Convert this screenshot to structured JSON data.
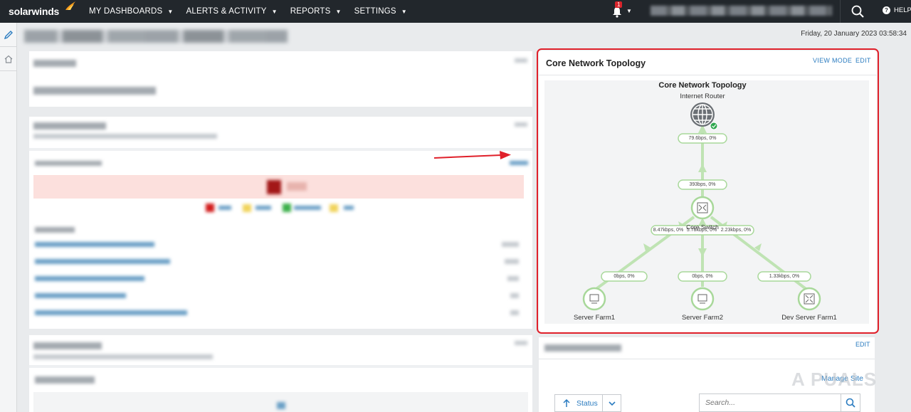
{
  "app": {
    "logo_text": "solarwinds"
  },
  "nav": {
    "items": [
      {
        "label": "MY DASHBOARDS"
      },
      {
        "label": "ALERTS & ACTIVITY"
      },
      {
        "label": "REPORTS"
      },
      {
        "label": "SETTINGS"
      }
    ],
    "notification_count": "1",
    "help_label": "HELP"
  },
  "header": {
    "datetime": "Friday, 20 January 2023 03:58:34"
  },
  "topology": {
    "title": "Core Network Topology",
    "view_mode_label": "VIEW MODE",
    "edit_label": "EDIT",
    "map_title": "Core Network Topology",
    "nodes": {
      "router": "Internet Router",
      "core_switch": "Core Switch",
      "farm1": "Server Farm1",
      "farm2": "Server Farm2",
      "dev_farm": "Dev Server Farm1"
    },
    "link_labels": {
      "router_down": "79.6bps, 0%",
      "switch_up": "393bps, 0%",
      "switch_left": "8.47kbps, 0%",
      "switch_center": "5.78kbps, 0%",
      "switch_right": "2.23kbps, 0%",
      "farm1": "0bps, 0%",
      "farm2": "0bps, 0%",
      "dev_farm": "1.33kbps, 0%"
    },
    "colors": {
      "link": "#bfe3b3",
      "node_border": "#a8d89a",
      "status_ok": "#2fa84f"
    }
  },
  "site_panel": {
    "edit_label": "EDIT",
    "manage_site_label": "Manage Site",
    "status_sort_label": "Status",
    "search_placeholder": "Search..."
  },
  "watermark": "A PUALS",
  "colors": {
    "nav_bg": "#22272c",
    "link": "#2b7cc0",
    "highlight": "#e0202a",
    "alert_banner": "#fce0dd"
  }
}
